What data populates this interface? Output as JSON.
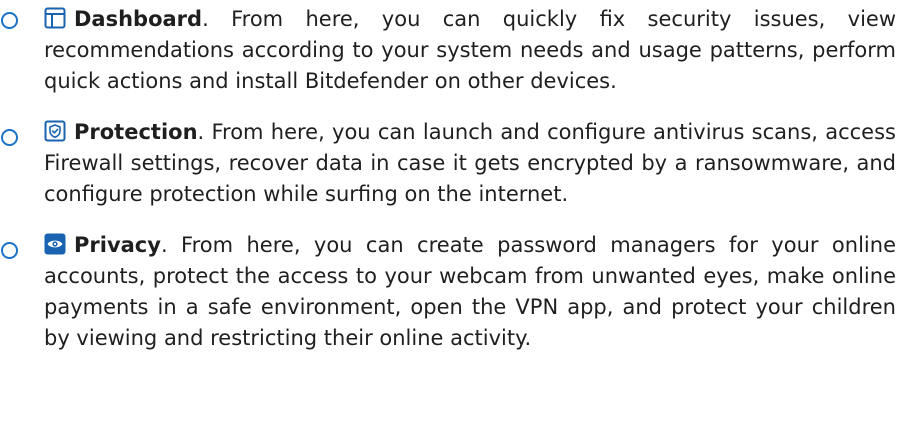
{
  "colors": {
    "bullet": "#1a73c8",
    "icon": "#1a63b0",
    "text": "#1f1f1f"
  },
  "sections": [
    {
      "icon": "dashboard-icon",
      "term": "Dashboard",
      "description": ". From here, you can quickly fix security issues, view recommendations according to your system needs and usage patterns, perform quick actions and install Bitdefender on other devices."
    },
    {
      "icon": "shield-check-icon",
      "term": "Protection",
      "description": ". From here, you can launch and configure antivirus scans, access Firewall settings, recover data in case it gets encrypted by a ransowmware, and configure protection while surfing on the internet."
    },
    {
      "icon": "eye-icon",
      "term": "Privacy",
      "description": ". From here, you can create password managers for your online accounts, protect the access to your webcam from unwanted eyes, make online payments in a safe environment, open the VPN app, and protect your children by viewing and restricting their online activity."
    }
  ]
}
